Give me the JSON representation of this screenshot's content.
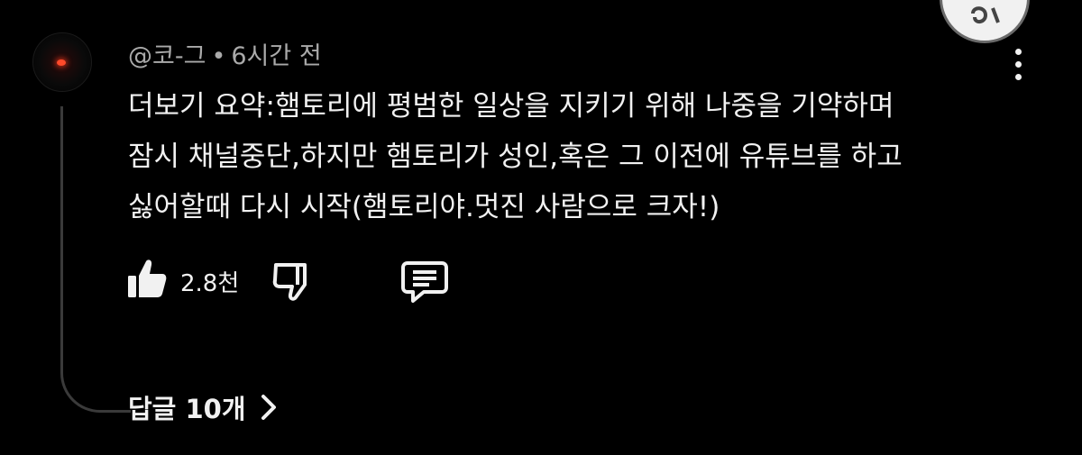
{
  "comment": {
    "author": "@코-그",
    "separator": "•",
    "time": "6시간 전",
    "lines": [
      "더보기 요약:햄토리에 평범한 일상을 지키기 위해 나중을 기약하며",
      "잠시 채널중단,하지만 햄토리가 성인,혹은 그 이전에 유튜브를 하고",
      "싫어할때 다시 시작(햄토리야.멋진 사람으로 크자!)"
    ],
    "like_count": "2.8천",
    "replies_label": "답글 10개"
  },
  "icons": {
    "like": "thumbs-up-icon",
    "dislike": "thumbs-down-icon",
    "reply": "comment-icon",
    "more": "more-vertical-icon",
    "chevron": "chevron-right-icon",
    "fab": "music-note-icon"
  },
  "colors": {
    "background": "#000000",
    "text": "#f1f1f1",
    "meta": "#aaaaaa",
    "thread_line": "#3a3a3a"
  }
}
